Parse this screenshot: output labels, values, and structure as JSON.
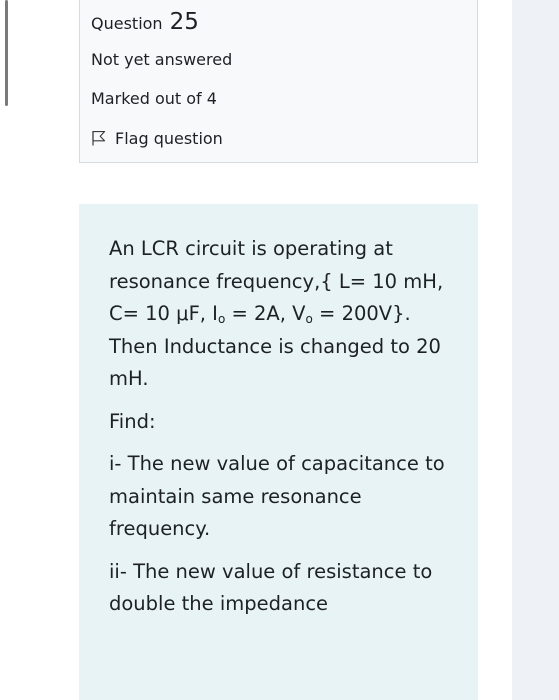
{
  "question_info": {
    "title_prefix": "Question",
    "number": "25",
    "state": "Not yet answered",
    "grade": "Marked out of 4",
    "flag_label": "Flag question"
  },
  "question_text": {
    "intro_1": "An LCR circuit is operating at resonance frequency,{ L= 10 mH, C= 10 μF, I",
    "i_sub": "o",
    "intro_2": " = 2A, V",
    "v_sub": "o",
    "intro_3": " = 200V}.  Then Inductance is changed to 20 mH.",
    "find": "Find:",
    "part_i": "i- The new value of capacitance to maintain same resonance frequency.",
    "part_ii": "ii- The new value of resistance to double the impedance"
  },
  "colors": {
    "content_background": "#e7f3f5",
    "info_background": "#f8f9fa",
    "text": "#1d2125"
  }
}
